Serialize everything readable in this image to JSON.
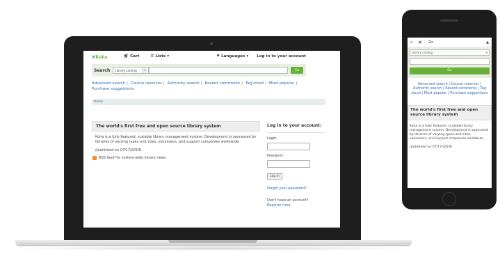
{
  "desktop": {
    "logo": "Koha",
    "nav": {
      "cart": "Cart",
      "lists": "Lists",
      "languages": "Languages",
      "login": "Log in to your account"
    },
    "search": {
      "label": "Search",
      "scope": "Library catalog",
      "go": "Go"
    },
    "links": [
      "Advanced search",
      "Course reserves",
      "Authority search",
      "Recent comments",
      "Tag cloud",
      "Most popular",
      "Purchase suggestions"
    ],
    "breadcrumb": "Home",
    "news": {
      "title": "The world's first free and open source library system",
      "body": "Koha is a fully featured, scalable library management system. Development is sponsored by libraries of varying types and sizes, volunteers, and support companies worldwide.",
      "date": "(published on 07/17/2019)",
      "rss": "RSS feed for system-wide library news."
    },
    "login_box": {
      "title": "Log in to your account:",
      "login_label": "Login:",
      "password_label": "Password:",
      "button": "Log in",
      "forgot": "Forgot your password?",
      "no_account": "Don't have an account?",
      "register": "Register here."
    }
  },
  "mobile": {
    "scope": "Library catalog",
    "go": "Go",
    "links": "Advanced search | Course reserves | Authority search | Recent comments | Tag cloud | Most popular | Purchase suggestions",
    "news_title": "The world's first free and open source library system",
    "news_body": "Koha is a fully featured, scalable library management system. Development is sponsored by libraries of varying types and sizes, volunteers, and support companies worldwide.",
    "news_date": "(published on 07/17/2019)"
  },
  "colors": {
    "brand_green": "#6aaf39",
    "link_blue": "#2b6bb3",
    "search_bg": "#e8efe2"
  }
}
